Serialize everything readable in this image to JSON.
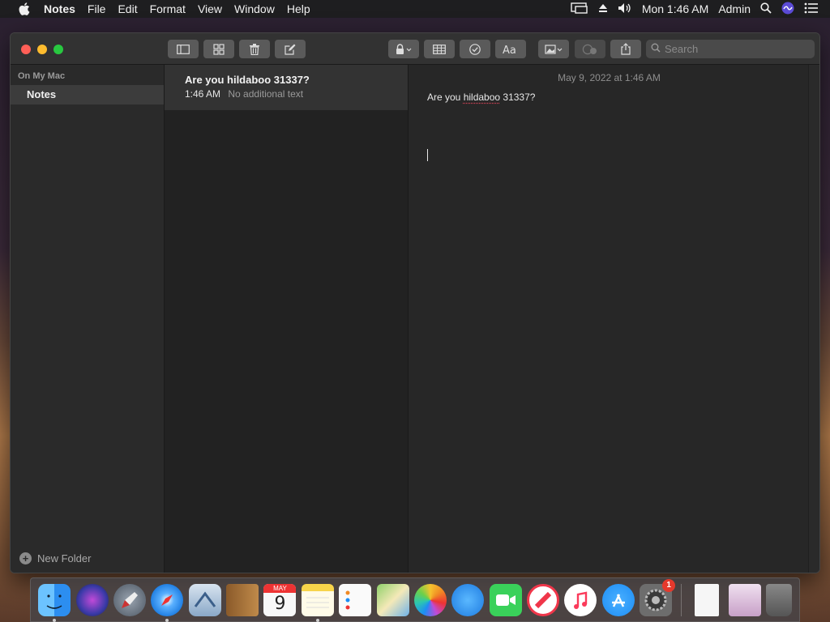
{
  "menubar": {
    "app_name": "Notes",
    "menus": [
      "File",
      "Edit",
      "Format",
      "View",
      "Window",
      "Help"
    ],
    "clock": "Mon 1:46 AM",
    "user": "Admin"
  },
  "toolbar": {
    "search_placeholder": "Search"
  },
  "sidebar": {
    "section_label": "On My Mac",
    "folders": [
      {
        "label": "Notes",
        "selected": true
      }
    ],
    "new_folder_label": "New Folder"
  },
  "note_list": {
    "items": [
      {
        "title": "Are you hildaboo 31337?",
        "time": "1:46 AM",
        "preview": "No additional text",
        "selected": true
      }
    ]
  },
  "editor": {
    "date": "May 9, 2022 at 1:46 AM",
    "text_before": "Are you ",
    "misspelled_word": "hildaboo",
    "text_after": " 31337?"
  },
  "dock": {
    "apps": [
      {
        "name": "finder-icon",
        "running": true
      },
      {
        "name": "siri-icon"
      },
      {
        "name": "launchpad-icon"
      },
      {
        "name": "safari-icon",
        "running": true
      },
      {
        "name": "mail-icon"
      },
      {
        "name": "contacts-icon"
      },
      {
        "name": "calendar-icon",
        "month": "MAY",
        "day": "9"
      },
      {
        "name": "notes-icon",
        "running": true
      },
      {
        "name": "reminders-icon"
      },
      {
        "name": "maps-icon"
      },
      {
        "name": "photos-icon"
      },
      {
        "name": "messages-icon"
      },
      {
        "name": "facetime-icon"
      },
      {
        "name": "news-icon"
      },
      {
        "name": "music-icon"
      },
      {
        "name": "app-store-icon"
      },
      {
        "name": "system-preferences-icon",
        "badge": "1"
      }
    ],
    "colors": {
      "finder": "#2c8ef0",
      "safari": "#1a7ae0",
      "facetime": "#3ad15a",
      "news": "#f0364a",
      "music": "#fb3a5a",
      "appstore": "#1d8df5"
    }
  }
}
